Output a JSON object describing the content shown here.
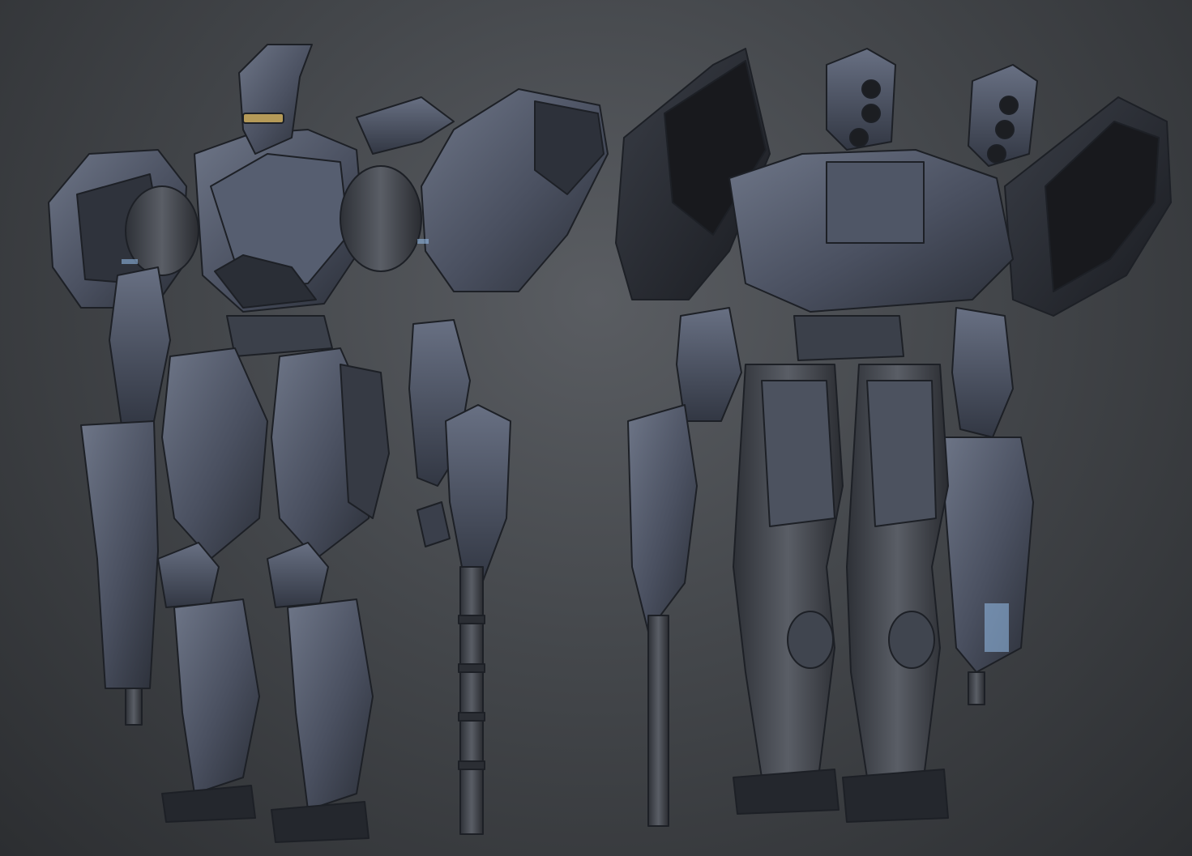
{
  "scene": {
    "subject_front": "mech-robot-front-view",
    "subject_back": "mech-robot-back-view",
    "colors": {
      "background_top": "#5a5d62",
      "background_bottom": "#2c2e31",
      "armor_base": "#4a5060",
      "armor_light": "#6e7688",
      "armor_dark": "#2b2f38",
      "joint_metal": "#3a3d44",
      "highlight_blue": "#8fb6e0",
      "visor_gold": "#b59a58"
    }
  }
}
